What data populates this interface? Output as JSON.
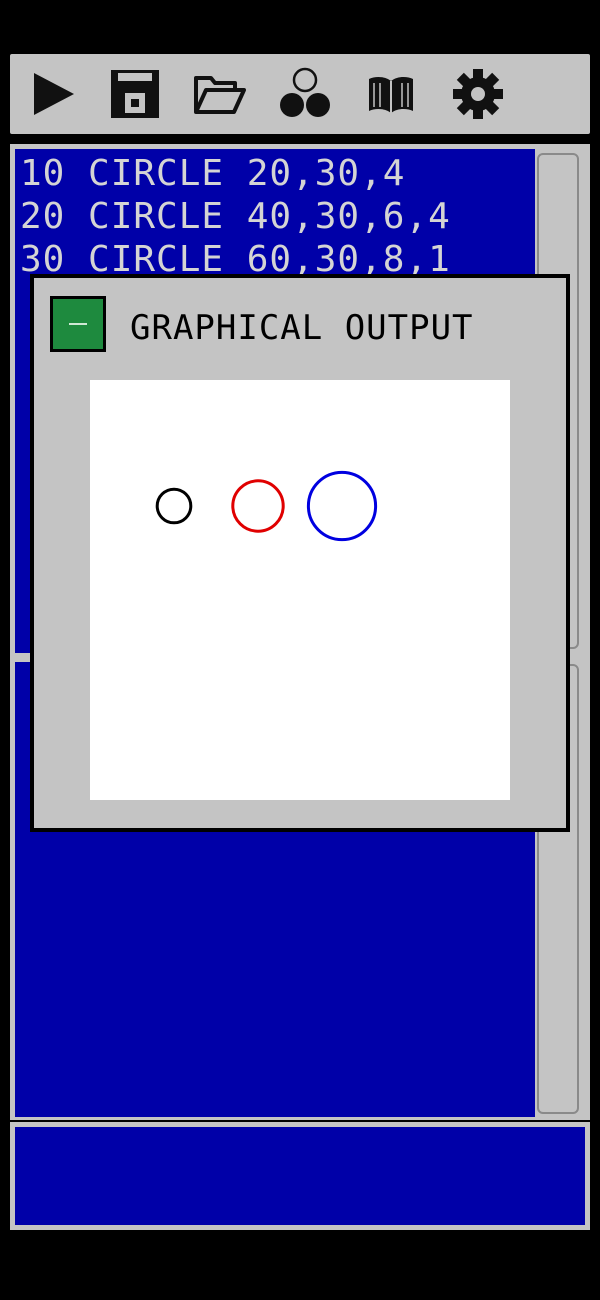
{
  "toolbar": {
    "buttons": [
      {
        "name": "run",
        "icon": "play-icon"
      },
      {
        "name": "save",
        "icon": "floppy-disk-icon"
      },
      {
        "name": "open",
        "icon": "folder-open-icon"
      },
      {
        "name": "examples",
        "icon": "circles-icon"
      },
      {
        "name": "manual",
        "icon": "book-icon"
      },
      {
        "name": "settings",
        "icon": "gear-icon"
      }
    ]
  },
  "editor": {
    "lines": [
      "10 CIRCLE 20,30,4",
      "20 CIRCLE 40,30,6,4",
      "30 CIRCLE 60,30,8,1"
    ]
  },
  "output_window": {
    "title": "GRAPHICAL OUTPUT",
    "minimize_icon": "minimize-icon",
    "circles": [
      {
        "x": 20,
        "y": 30,
        "r": 4,
        "color": "#000000"
      },
      {
        "x": 40,
        "y": 30,
        "r": 6,
        "color": "#e00000"
      },
      {
        "x": 60,
        "y": 30,
        "r": 8,
        "color": "#0000e0"
      }
    ]
  },
  "colors": {
    "editor_background": "#0000a8",
    "editor_text": "#d4d4d4",
    "chrome": "#c4c4c4",
    "minimize_button": "#1e8a3e"
  }
}
